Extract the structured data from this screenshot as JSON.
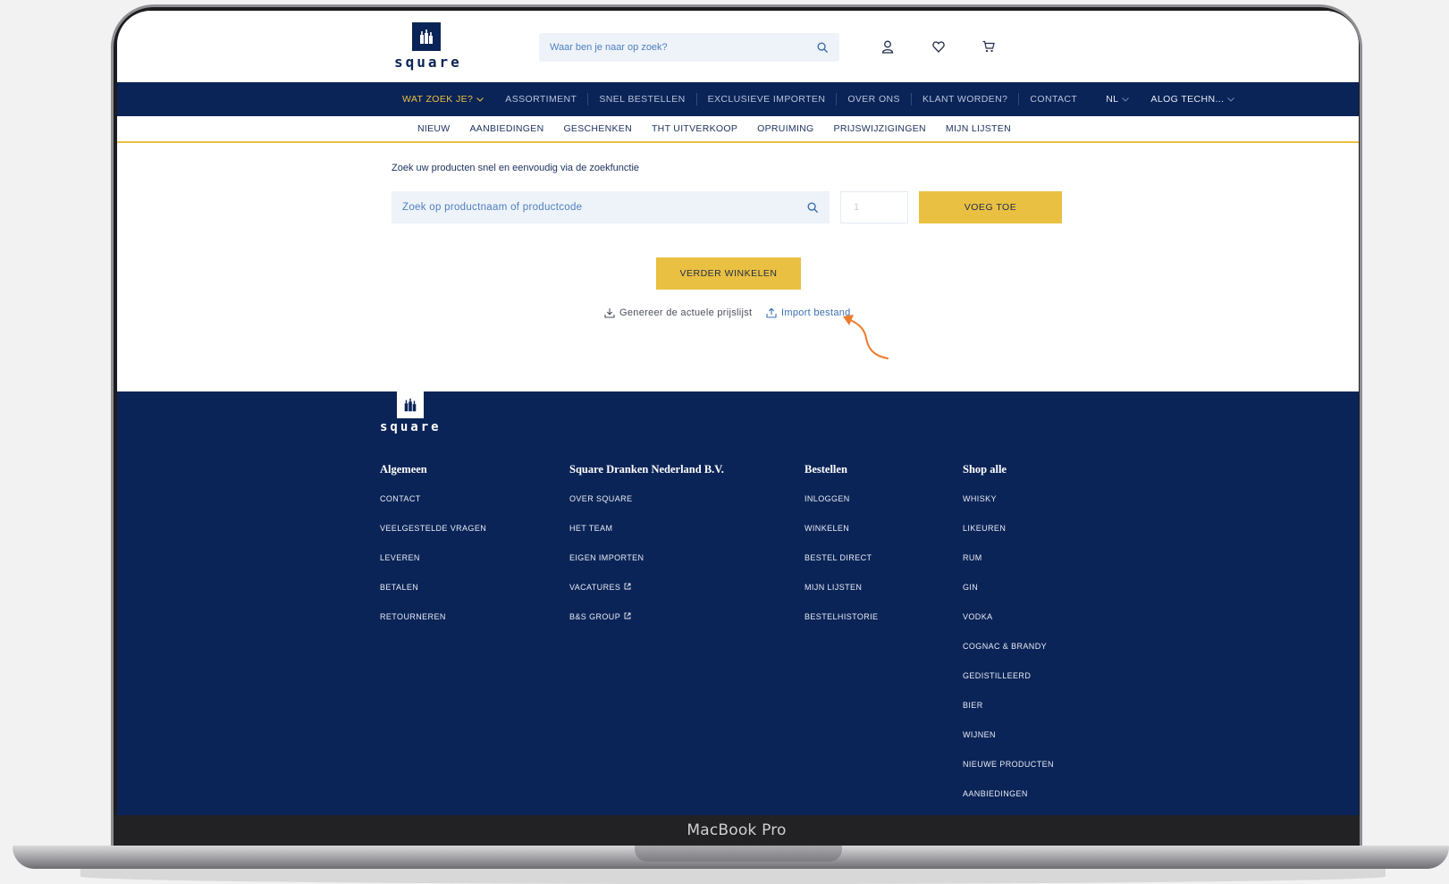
{
  "device": {
    "label": "MacBook Pro"
  },
  "brand": {
    "logo_text": "square",
    "navy": "#0b2457",
    "accent": "#e9c042"
  },
  "header": {
    "search_placeholder": "Waar ben je naar op zoek?",
    "icons": [
      "user-icon",
      "heart-icon",
      "cart-icon"
    ]
  },
  "mainnav": {
    "items": [
      {
        "label": "WAT ZOEK JE?"
      },
      {
        "label": "ASSORTIMENT"
      },
      {
        "label": "SNEL BESTELLEN"
      },
      {
        "label": "EXCLUSIEVE IMPORTEN"
      },
      {
        "label": "OVER ONS"
      },
      {
        "label": "KLANT WORDEN?"
      },
      {
        "label": "CONTACT"
      }
    ],
    "language": "NL",
    "account": "ALOG TECHN..."
  },
  "subnav": {
    "items": [
      "NIEUW",
      "AANBIEDINGEN",
      "GESCHENKEN",
      "THT UITVERKOOP",
      "OPRUIMING",
      "PRIJSWIJZIGINGEN",
      "MIJN LIJSTEN"
    ]
  },
  "main": {
    "intro": "Zoek uw producten snel en eenvoudig via de zoekfunctie",
    "search_placeholder": "Zoek op productnaam of productcode",
    "qty_placeholder": "1",
    "add_label": "VOEG TOE",
    "continue_label": "VERDER WINKELEN",
    "price_list_label": "Genereer de actuele prijslijst",
    "import_label": "Import bestand"
  },
  "footer": {
    "logo_text": "square",
    "columns": [
      {
        "heading": "Algemeen",
        "links": [
          "CONTACT",
          "VEELGESTELDE VRAGEN",
          "LEVEREN",
          "BETALEN",
          "RETOURNEREN"
        ]
      },
      {
        "heading": "Square Dranken Nederland B.V.",
        "links": [
          "OVER SQUARE",
          "HET TEAM",
          "EIGEN IMPORTEN",
          "VACATURES",
          "B&S GROUP"
        ]
      },
      {
        "heading": "Bestellen",
        "links": [
          "INLOGGEN",
          "WINKELEN",
          "BESTEL DIRECT",
          "MIJN LIJSTEN",
          "BESTELHISTORIE"
        ]
      },
      {
        "heading": "Shop alle",
        "links": [
          "WHISKY",
          "LIKEUREN",
          "RUM",
          "GIN",
          "VODKA",
          "COGNAC & BRANDY",
          "GEDISTILLEERD",
          "BIER",
          "WIJNEN",
          "NIEUWE PRODUCTEN",
          "AANBIEDINGEN"
        ]
      }
    ]
  },
  "annotation": {
    "color": "#ee7a2c"
  }
}
